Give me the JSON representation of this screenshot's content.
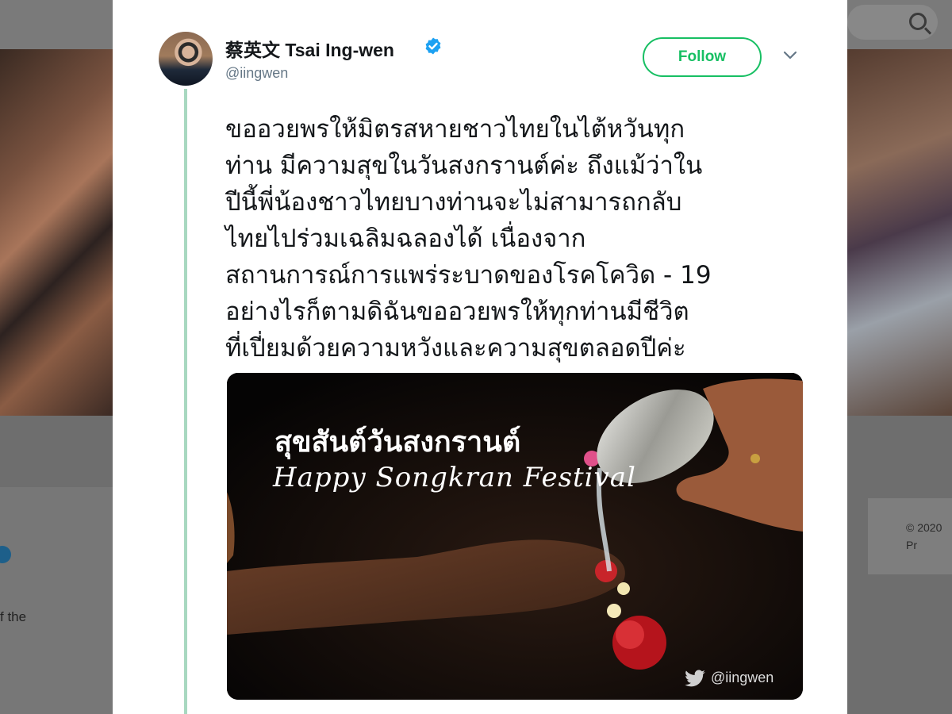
{
  "background": {
    "left_text": "f the",
    "right_lines": [
      "© 2020",
      "Pr"
    ]
  },
  "tweet": {
    "author_name": "蔡英文 Tsai Ing-wen",
    "handle": "@iingwen",
    "follow_label": "Follow",
    "text_lines": [
      "ขออวยพรให้มิตรสหายชาวไทยในไต้หวันทุก",
      "ท่าน มีความสุขในวันสงกรานต์ค่ะ ถึงแม้ว่าใน",
      "ปีนี้พี่น้องชาวไทยบางท่านจะไม่สามารถกลับ",
      "ไทยไปร่วมเฉลิมฉลองได้ เนื่องจาก",
      "สถานการณ์การแพร่ระบาดของโรคโควิด - 19",
      "อย่างไรก็ตามดิฉันขออวยพรให้ทุกท่านมีชีวิต",
      "ที่เปี่ยมด้วยความหวังและความสุขตลอดปีค่ะ"
    ],
    "media": {
      "title_thai": "สุขสันต์วันสงกรานต์",
      "title_english": "Happy Songkran Festival",
      "watermark_handle": "@iingwen"
    }
  },
  "colors": {
    "follow_green": "#17bf63",
    "verified_blue": "#1da1f2",
    "thread_line": "#a8d8c0"
  },
  "icons": [
    "search-icon",
    "verified-badge-icon",
    "chevron-down-icon",
    "twitter-bird-icon"
  ]
}
